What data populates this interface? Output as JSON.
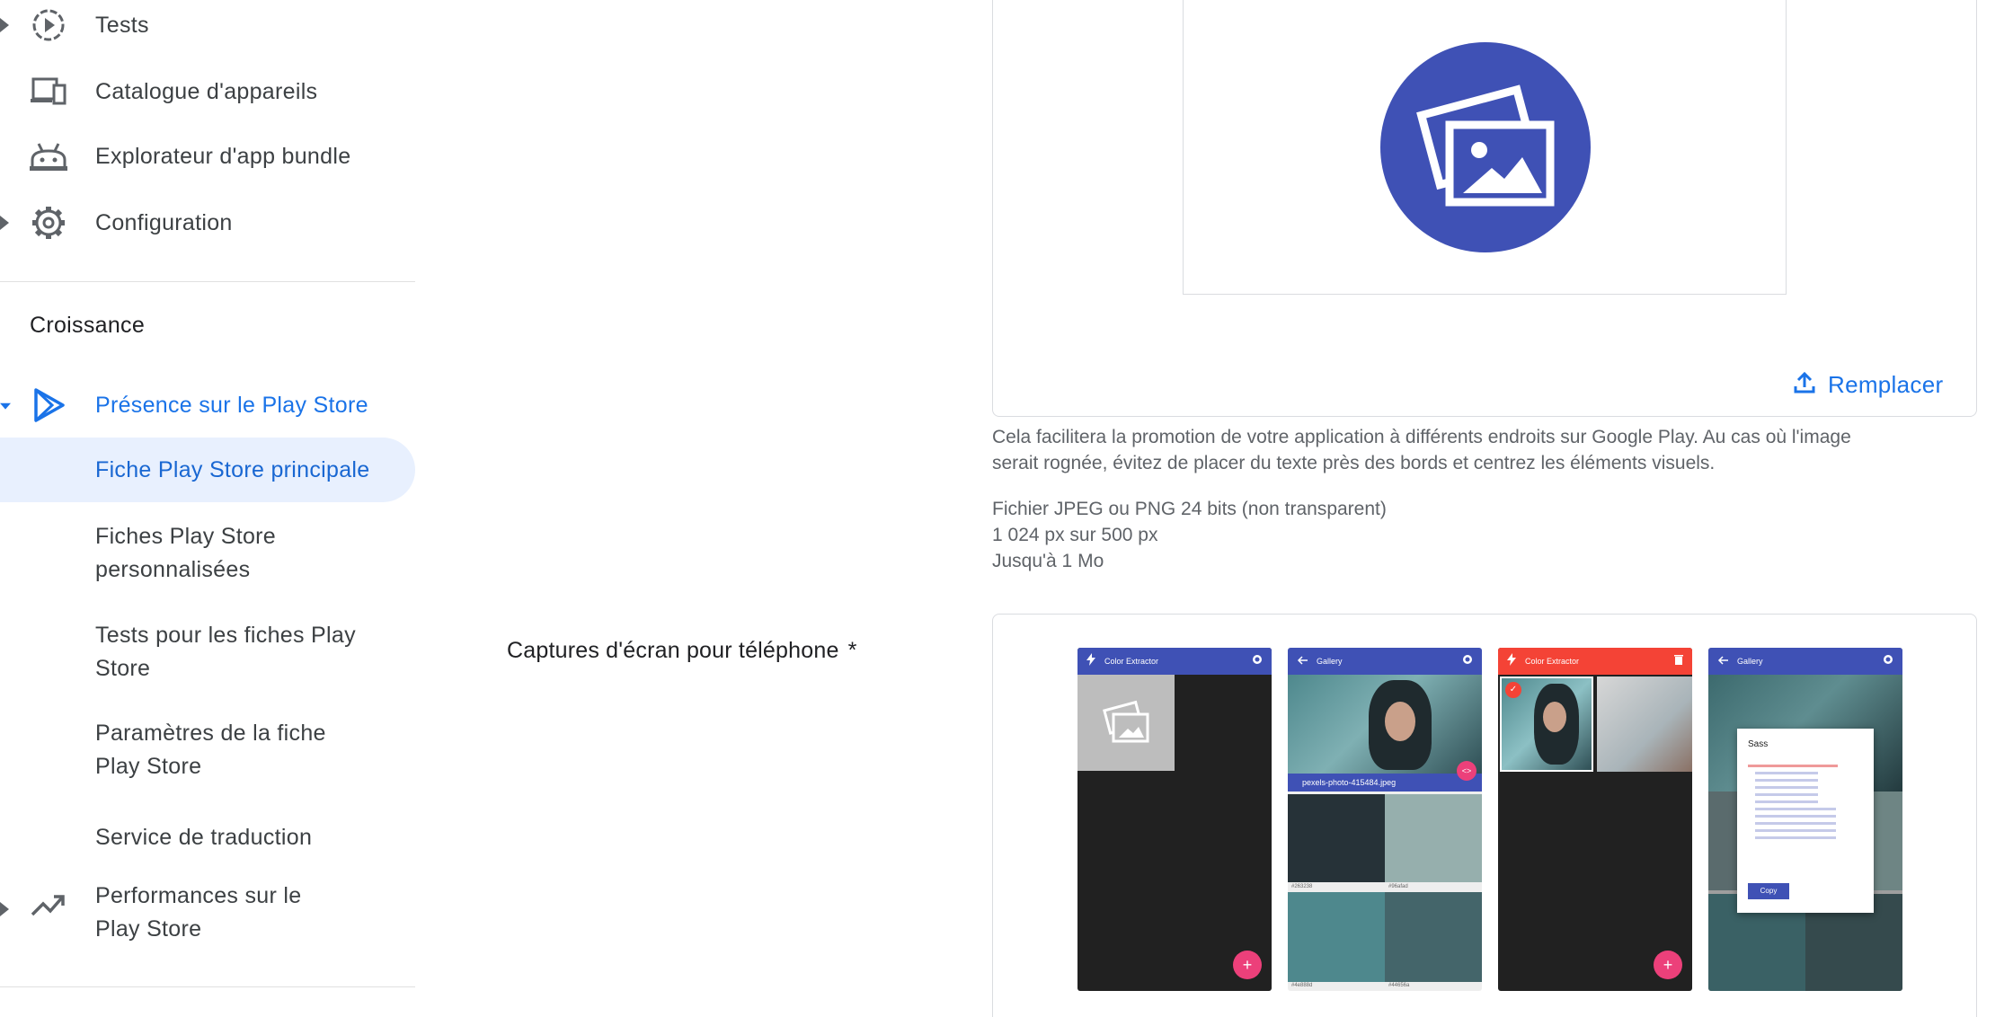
{
  "sidebar": {
    "items": [
      {
        "label": "Tests",
        "icon": "play-circle-icon"
      },
      {
        "label": "Catalogue d'appareils",
        "icon": "devices-icon"
      },
      {
        "label": "Explorateur d'app bundle",
        "icon": "android-icon"
      },
      {
        "label": "Configuration",
        "icon": "gear-icon"
      }
    ],
    "section_title": "Croissance",
    "presence": {
      "label": "Présence sur le Play Store",
      "icon": "play-store-icon"
    },
    "sub_items": [
      {
        "label": "Fiche Play Store principale"
      },
      {
        "label": "Fiches Play Store personnalisées"
      },
      {
        "label": "Tests pour les fiches Play Store"
      },
      {
        "label": "Paramètres de la fiche Play Store"
      },
      {
        "label": "Service de traduction"
      }
    ],
    "performance": {
      "label": "Performances sur le Play Store",
      "icon": "trending-up-icon"
    }
  },
  "feature_graphic": {
    "replace_label": "Remplacer",
    "help_line1": "Cela facilitera la promotion de votre application à différents endroits sur Google Play. Au cas où l'image",
    "help_line2": "serait rognée, évitez de placer du texte près des bords et centrez les éléments visuels.",
    "req_line1": "Fichier JPEG ou PNG 24 bits (non transparent)",
    "req_line2": "1 024 px sur 500 px",
    "req_line3": "Jusqu'à 1 Mo"
  },
  "screenshots": {
    "label": "Captures d'écran pour téléphone",
    "required_mark": "*",
    "phones": [
      {
        "title": "Color Extractor"
      },
      {
        "title": "Gallery",
        "filename": "pexels-photo-415484.jpeg",
        "codes": [
          "#263238",
          "#96afad",
          "#4e888d",
          "#44656a"
        ]
      },
      {
        "title": "Color Extractor"
      },
      {
        "title": "Gallery",
        "dialog_title": "Sass",
        "dialog_button": "Copy"
      }
    ]
  },
  "colors": {
    "accent": "#1a73e8",
    "active_bg": "#e8f0fe",
    "logo_blue": "#3f51b5",
    "fab_pink": "#ec407a",
    "appbar_blue": "#3f51b5",
    "appbar_red": "#f44336"
  }
}
